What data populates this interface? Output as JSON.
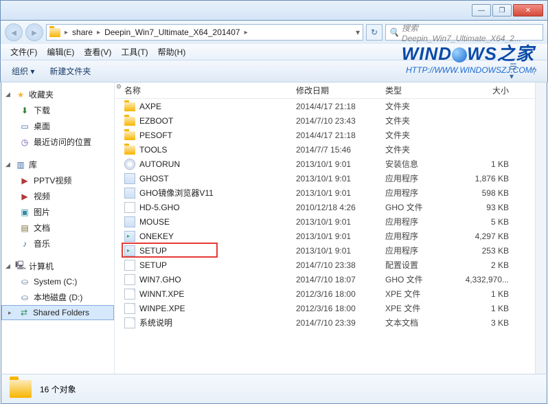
{
  "titlebar": {
    "min": "—",
    "max": "❐",
    "close": "✕"
  },
  "address": {
    "crumbs": [
      "share",
      "Deepin_Win7_Ultimate_X64_201407"
    ],
    "refresh": "↻",
    "search_placeholder": "搜索 Deepin_Win7_Ultimate_X64_2..."
  },
  "menus": [
    {
      "label": "文件(F)"
    },
    {
      "label": "编辑(E)"
    },
    {
      "label": "查看(V)"
    },
    {
      "label": "工具(T)"
    },
    {
      "label": "帮助(H)"
    }
  ],
  "toolbar": {
    "organize": "组织 ▾",
    "newfolder": "新建文件夹",
    "view": "▦",
    "help": "?"
  },
  "sidebar": {
    "favorites": {
      "label": "收藏夹",
      "items": [
        {
          "label": "下载",
          "icon": "download-icon"
        },
        {
          "label": "桌面",
          "icon": "desktop-icon"
        },
        {
          "label": "最近访问的位置",
          "icon": "recent-icon"
        }
      ]
    },
    "libraries": {
      "label": "库",
      "items": [
        {
          "label": "PPTV视频",
          "icon": "video-icon"
        },
        {
          "label": "视频",
          "icon": "video-icon"
        },
        {
          "label": "图片",
          "icon": "pictures-icon"
        },
        {
          "label": "文档",
          "icon": "documents-icon"
        },
        {
          "label": "音乐",
          "icon": "music-icon"
        }
      ]
    },
    "computer": {
      "label": "计算机",
      "items": [
        {
          "label": "System (C:)",
          "icon": "drive-icon"
        },
        {
          "label": "本地磁盘 (D:)",
          "icon": "drive-icon"
        },
        {
          "label": "Shared Folders",
          "icon": "network-folder-icon",
          "selected": true
        }
      ]
    }
  },
  "columns": {
    "name": "名称",
    "date": "修改日期",
    "type": "类型",
    "size": "大小"
  },
  "files": [
    {
      "icon": "folder",
      "name": "AXPE",
      "date": "2014/4/17 21:18",
      "type": "文件夹",
      "size": ""
    },
    {
      "icon": "folder",
      "name": "EZBOOT",
      "date": "2014/7/10 23:43",
      "type": "文件夹",
      "size": ""
    },
    {
      "icon": "folder",
      "name": "PESOFT",
      "date": "2014/4/17 21:18",
      "type": "文件夹",
      "size": ""
    },
    {
      "icon": "folder",
      "name": "TOOLS",
      "date": "2014/7/7 15:46",
      "type": "文件夹",
      "size": ""
    },
    {
      "icon": "disc",
      "name": "AUTORUN",
      "date": "2013/10/1 9:01",
      "type": "安装信息",
      "size": "1 KB"
    },
    {
      "icon": "exe",
      "name": "GHOST",
      "date": "2013/10/1 9:01",
      "type": "应用程序",
      "size": "1,876 KB"
    },
    {
      "icon": "exe",
      "name": "GHO镜像浏览器V11",
      "date": "2013/10/1 9:01",
      "type": "应用程序",
      "size": "598 KB"
    },
    {
      "icon": "gho",
      "name": "HD-5.GHO",
      "date": "2010/12/18 4:26",
      "type": "GHO 文件",
      "size": "93 KB"
    },
    {
      "icon": "exe",
      "name": "MOUSE",
      "date": "2013/10/1 9:01",
      "type": "应用程序",
      "size": "5 KB"
    },
    {
      "icon": "setup",
      "name": "ONEKEY",
      "date": "2013/10/1 9:01",
      "type": "应用程序",
      "size": "4,297 KB"
    },
    {
      "icon": "setup",
      "name": "SETUP",
      "date": "2013/10/1 9:01",
      "type": "应用程序",
      "size": "253 KB",
      "highlighted": true
    },
    {
      "icon": "cfg",
      "name": "SETUP",
      "date": "2014/7/10 23:38",
      "type": "配置设置",
      "size": "2 KB"
    },
    {
      "icon": "gho",
      "name": "WIN7.GHO",
      "date": "2014/7/10 18:07",
      "type": "GHO 文件",
      "size": "4,332,970..."
    },
    {
      "icon": "file",
      "name": "WINNT.XPE",
      "date": "2012/3/16 18:00",
      "type": "XPE 文件",
      "size": "1 KB"
    },
    {
      "icon": "file",
      "name": "WINPE.XPE",
      "date": "2012/3/16 18:00",
      "type": "XPE 文件",
      "size": "1 KB"
    },
    {
      "icon": "file",
      "name": "系统说明",
      "date": "2014/7/10 23:39",
      "type": "文本文档",
      "size": "3 KB"
    }
  ],
  "status": {
    "count": "16 个对象"
  },
  "watermark": {
    "text_windows": "WIND",
    "text_ws": "WS",
    "text_zh": "之家",
    "url": "HTTP://WWW.WINDOWSZJ.COM/"
  }
}
